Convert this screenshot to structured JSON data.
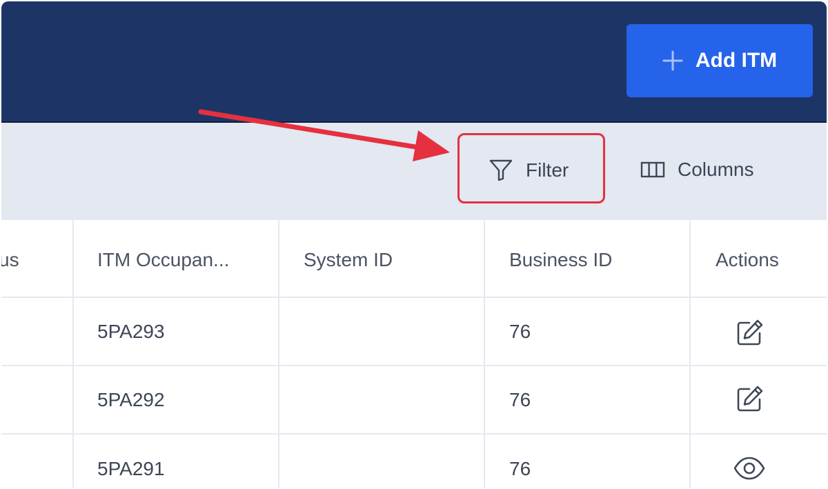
{
  "header": {
    "add_button_label": "Add ITM",
    "add_button_icon": "plus-icon"
  },
  "toolbar": {
    "filter_label": "Filter",
    "filter_icon": "filter-funnel-icon",
    "columns_label": "Columns",
    "columns_icon": "columns-icon"
  },
  "table": {
    "columns": [
      "us",
      "ITM Occupan...",
      "System ID",
      "Business ID",
      "Actions"
    ],
    "rows": [
      {
        "status": "",
        "itm_occupant": "5PA293",
        "system_id": "",
        "business_id": "76",
        "action_icon": "edit-icon"
      },
      {
        "status": "",
        "itm_occupant": "5PA292",
        "system_id": "",
        "business_id": "76",
        "action_icon": "edit-icon"
      },
      {
        "status": "",
        "itm_occupant": "5PA291",
        "system_id": "",
        "business_id": "76",
        "action_icon": "eye-icon"
      }
    ]
  },
  "colors": {
    "header_bg": "#1d3566",
    "primary_button": "#2563eb",
    "toolbar_bg": "#e3e8f1",
    "annotation_red": "#e5303f"
  }
}
